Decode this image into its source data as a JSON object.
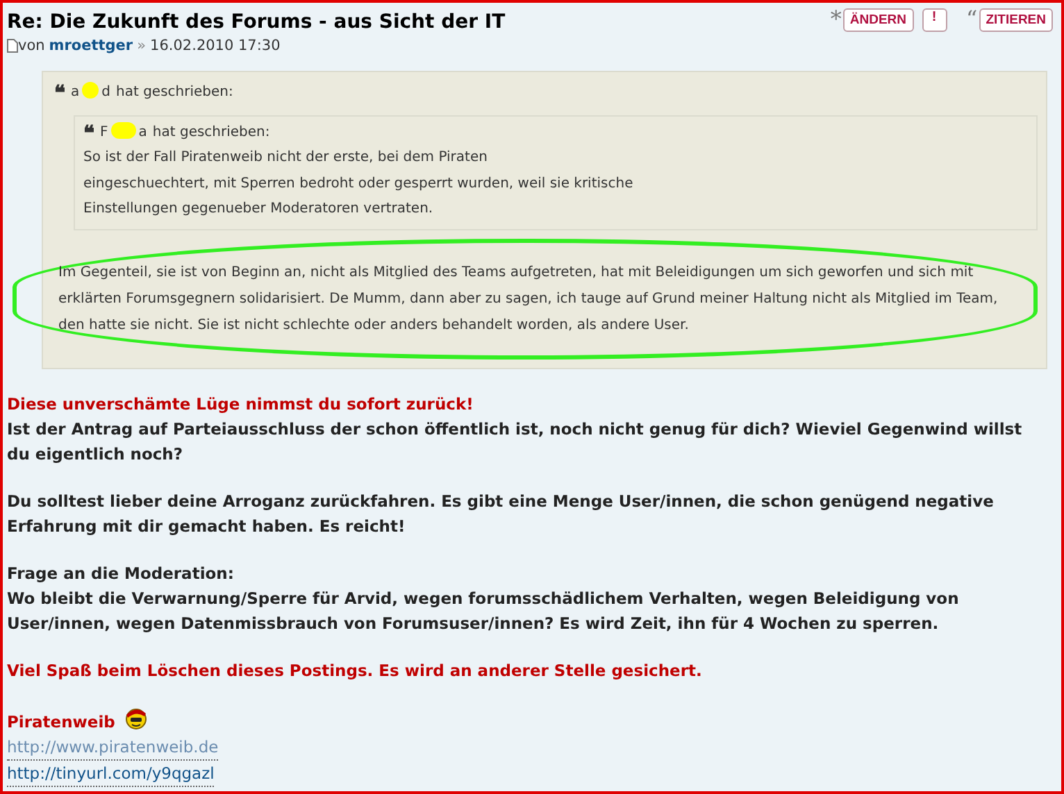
{
  "post": {
    "title": "Re: Die Zukunft des Forums - aus Sicht der IT",
    "meta": {
      "by": "von",
      "author": "mroettger",
      "separator": "»",
      "date": "16.02.2010 17:30"
    },
    "buttons": [
      {
        "kind": "edit",
        "icon": "*",
        "label": "ÄNDERN"
      },
      {
        "kind": "report",
        "label": "!"
      },
      {
        "kind": "quote",
        "icon": "“",
        "label": "ZITIEREN"
      }
    ]
  },
  "quote": {
    "quote_mark": "❝",
    "author_before": "a",
    "author_after": "d",
    "said": "hat geschrieben:",
    "inner": {
      "quote_mark": "❝",
      "author_before": "F",
      "author_after": "a",
      "said": "hat geschrieben:",
      "lines": [
        "So ist der Fall Piratenweib nicht der erste, bei dem Piraten",
        "eingeschuechtert, mit Sperren bedroht oder gesperrt wurden, weil sie kritische",
        "Einstellungen gegenueber Moderatoren vertraten."
      ]
    },
    "reply": "Im Gegenteil, sie ist von Beginn an, nicht als Mitglied des Teams aufgetreten, hat mit Beleidigungen um sich geworfen und sich mit erklärten Forumsgegnern solidarisiert. De Mumm, dann aber zu sagen, ich tauge auf Grund meiner Haltung nicht als Mitglied im Team, den hatte sie nicht. Sie ist nicht schlechte oder anders behandelt worden, als andere User."
  },
  "paragraphs": [
    {
      "lines": [
        {
          "text": "Diese unverschämte Lüge nimmst du sofort zurück!",
          "kind": "red"
        },
        {
          "text": "Ist der Antrag auf Parteiausschluss der schon öffentlich ist, noch nicht genug für dich? Wieviel Gegenwind willst du eigentlich noch?",
          "kind": "normal"
        }
      ]
    },
    {
      "lines": [
        {
          "text": "Du solltest lieber deine Arroganz zurückfahren. Es gibt eine Menge User/innen, die schon genügend negative Erfahrung mit dir gemacht haben. Es reicht!",
          "kind": "normal"
        }
      ]
    },
    {
      "lines": [
        {
          "text": "Frage an die Moderation:",
          "kind": "normal"
        },
        {
          "text": "Wo bleibt die Verwarnung/Sperre für Arvid, wegen forumsschädlichem Verhalten, wegen Beleidigung von User/innen, wegen Datenmissbrauch von Forumsuser/innen? Es wird Zeit, ihn für 4 Wochen zu sperren.",
          "kind": "normal"
        }
      ]
    },
    {
      "lines": [
        {
          "text": "Viel Spaß beim Löschen dieses Postings. Es wird an anderer Stelle gesichert.",
          "kind": "red"
        }
      ]
    }
  ],
  "signature": {
    "name": "Piratenweib",
    "links": [
      {
        "text": "http://www.piratenweib.de",
        "kind": "faded"
      },
      {
        "text": "http://tinyurl.com/y9qgazl",
        "kind": "dark"
      }
    ]
  }
}
